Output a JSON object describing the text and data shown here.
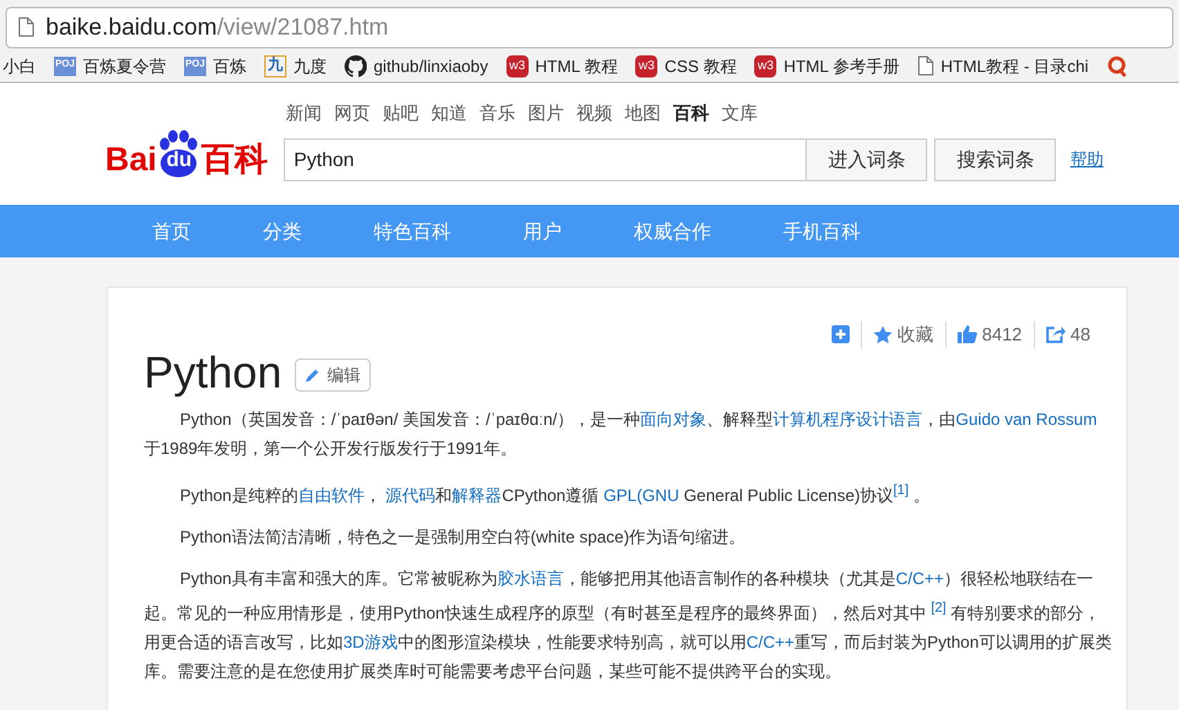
{
  "browser": {
    "url_host": "baike.baidu.com",
    "url_path": "/view/21087.htm"
  },
  "bookmarks": [
    {
      "label": "小白",
      "kind": "plain"
    },
    {
      "label": "百炼夏令营",
      "kind": "poj",
      "badge": "POJ"
    },
    {
      "label": "百炼",
      "kind": "poj",
      "badge": "POJ"
    },
    {
      "label": "九度",
      "kind": "jiu",
      "badge": "九"
    },
    {
      "label": "github/linxiaoby",
      "kind": "github"
    },
    {
      "label": "HTML 教程",
      "kind": "w3",
      "badge": "w3"
    },
    {
      "label": "CSS 教程",
      "kind": "w3",
      "badge": "w3"
    },
    {
      "label": "HTML 参考手册",
      "kind": "w3",
      "badge": "w3"
    },
    {
      "label": "HTML教程 - 目录chi",
      "kind": "page"
    },
    {
      "kind": "q"
    }
  ],
  "logo": {
    "left": "Bai",
    "paw": "du",
    "right": "百科"
  },
  "channels": [
    {
      "label": "新闻",
      "selected": false
    },
    {
      "label": "网页",
      "selected": false
    },
    {
      "label": "贴吧",
      "selected": false
    },
    {
      "label": "知道",
      "selected": false
    },
    {
      "label": "音乐",
      "selected": false
    },
    {
      "label": "图片",
      "selected": false
    },
    {
      "label": "视频",
      "selected": false
    },
    {
      "label": "地图",
      "selected": false
    },
    {
      "label": "百科",
      "selected": true
    },
    {
      "label": "文库",
      "selected": false
    }
  ],
  "search": {
    "value": "Python",
    "buttons": [
      "进入词条",
      "搜索词条"
    ],
    "help": "帮助"
  },
  "nav": [
    "首页",
    "分类",
    "特色百科",
    "用户",
    "权威合作",
    "手机百科"
  ],
  "article": {
    "tools": [
      {
        "kind": "add"
      },
      {
        "kind": "star",
        "label": "收藏"
      },
      {
        "kind": "like",
        "label": "8412"
      },
      {
        "kind": "share",
        "label": "48"
      }
    ],
    "title": "Python",
    "edit": "编辑",
    "paragraphs": [
      [
        {
          "kind": "text",
          "t": "Python（英国发音：/ˈpaɪθən/ 美国发音：/ˈpaɪθɑːn/），是一种"
        },
        {
          "kind": "link",
          "t": "面向对象"
        },
        {
          "kind": "text",
          "t": "、解释型"
        },
        {
          "kind": "link",
          "t": "计算机程序设计语言"
        },
        {
          "kind": "text",
          "t": "，由"
        },
        {
          "kind": "link",
          "t": "Guido van Rossum"
        },
        {
          "kind": "text",
          "t": "于1989年发明，第一个公开发行版发行于1991年。"
        }
      ],
      [
        {
          "kind": "text",
          "t": "Python是纯粹的"
        },
        {
          "kind": "link",
          "t": "自由软件"
        },
        {
          "kind": "text",
          "t": "， "
        },
        {
          "kind": "link",
          "t": "源代码"
        },
        {
          "kind": "text",
          "t": "和"
        },
        {
          "kind": "link",
          "t": "解释器"
        },
        {
          "kind": "text",
          "t": "CPython遵循 "
        },
        {
          "kind": "link",
          "t": "GPL(GNU"
        },
        {
          "kind": "text",
          "t": " General Public License)协议"
        },
        {
          "kind": "ref",
          "t": "[1]"
        },
        {
          "kind": "text",
          "t": " 。"
        }
      ],
      [
        {
          "kind": "text",
          "t": "Python语法简洁清晰，特色之一是强制用空白符(white space)作为语句缩进。"
        }
      ],
      [
        {
          "kind": "text",
          "t": "Python具有丰富和强大的库。它常被昵称为"
        },
        {
          "kind": "link",
          "t": "胶水语言"
        },
        {
          "kind": "text",
          "t": "，能够把用其他语言制作的各种模块（尤其是"
        },
        {
          "kind": "link",
          "t": "C/C++"
        },
        {
          "kind": "text",
          "t": "）很轻松地联结在一起。常见的一种应用情形是，使用Python快速生成程序的原型（有时甚至是程序的最终界面），然后对其中 "
        },
        {
          "kind": "ref",
          "t": "[2]"
        },
        {
          "kind": "text",
          "t": " 有特别要求的部分，用更合适的语言改写，比如"
        },
        {
          "kind": "link",
          "t": "3D游戏"
        },
        {
          "kind": "text",
          "t": "中的图形渲染模块，性能要求特别高，就可以用"
        },
        {
          "kind": "link",
          "t": "C/C++"
        },
        {
          "kind": "text",
          "t": "重写，而后封装为Python可以调用的扩展类库。需要注意的是在您使用扩展类库时可能需要考虑平台问题，某些可能不提供跨平台的实现。"
        }
      ]
    ]
  }
}
